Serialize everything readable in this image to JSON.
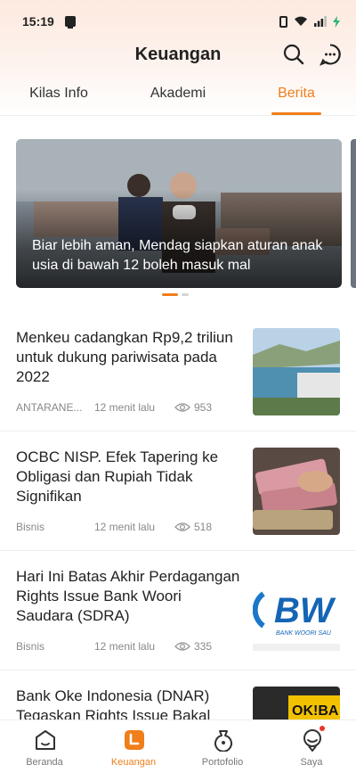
{
  "status_bar": {
    "time": "15:19"
  },
  "header": {
    "title": "Keuangan"
  },
  "tabs": [
    {
      "label": "Kilas Info"
    },
    {
      "label": "Akademi"
    },
    {
      "label": "Berita"
    }
  ],
  "carousel": {
    "caption": "Biar lebih aman, Mendag siapkan aturan anak usia di bawah 12 boleh masuk mal"
  },
  "news": [
    {
      "title": "Menkeu cadangkan Rp9,2 triliun untuk dukung pariwisata pada 2022",
      "source": "ANTARANE...",
      "time": "12 menit lalu",
      "views": "953"
    },
    {
      "title": "OCBC NISP. Efek Tapering ke Obligasi dan Rupiah Tidak Signifikan",
      "source": "Bisnis",
      "time": "12 menit lalu",
      "views": "518"
    },
    {
      "title": "Hari Ini Batas Akhir Perdagangan Rights Issue Bank Woori Saudara (SDRA)",
      "source": "Bisnis",
      "time": "12 menit lalu",
      "views": "335"
    },
    {
      "title": "Bank Oke Indonesia (DNAR) Tegaskan Rights Issue Bakal",
      "source": "",
      "time": "",
      "views": ""
    }
  ],
  "thumbs": {
    "bw_logo": "BW",
    "bw_sub": "BANK WOORI SAU",
    "oke_logo": "OK!BA"
  },
  "bottom_nav": [
    {
      "label": "Beranda"
    },
    {
      "label": "Keuangan"
    },
    {
      "label": "Portofolio"
    },
    {
      "label": "Saya"
    }
  ],
  "colors": {
    "accent": "#f07e1a",
    "badge": "#e8352b"
  }
}
